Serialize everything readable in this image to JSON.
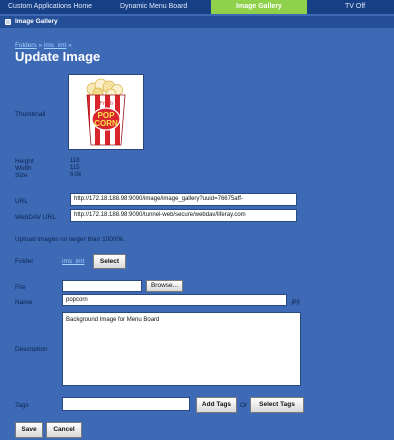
{
  "tabs": [
    {
      "label": "Custom Applications Home",
      "active": false
    },
    {
      "label": "Dynamic Menu Board",
      "active": false
    },
    {
      "label": "Image Gallery",
      "active": true
    },
    {
      "label": "TV Off",
      "active": false
    }
  ],
  "portlet": {
    "title": "Image Gallery"
  },
  "breadcrumb": {
    "item1": "Folders",
    "item2": "ims_imt"
  },
  "page_title": "Update Image",
  "thumbnail": {
    "label": "Thumbnail",
    "brand": "Fresh",
    "text_line1": "POP",
    "text_line2": "CORN"
  },
  "metadata": {
    "height_label": "Height",
    "height_value": "118",
    "width_label": "Width",
    "width_value": "115",
    "size_label": "Size",
    "size_value": "6.0k"
  },
  "url": {
    "label": "URL",
    "value": "http://172.18.188.98:9090/image/image_gallery?uuid=76675aff-"
  },
  "webdav_url": {
    "label": "WebDAV URL",
    "value": "http://172.18.188.98:9090/tunnel-web/secure/webdav/liferay.com"
  },
  "upload_note": "Upload images no larger than 10000k.",
  "folder": {
    "label": "Folder",
    "link": "ims_imt",
    "select_button": "Select"
  },
  "file": {
    "label": "File",
    "value": "",
    "browse_button": "Browse..."
  },
  "name": {
    "label": "Name",
    "value": "popcorn",
    "extension": ".jpg"
  },
  "description": {
    "label": "Description",
    "value": "Background Image for Menu Board"
  },
  "tags": {
    "label": "Tags",
    "value": "",
    "add_button": "Add Tags",
    "or_text": "Or",
    "select_button": "Select Tags"
  },
  "actions": {
    "save": "Save",
    "cancel": "Cancel"
  },
  "colors": {
    "background": "#3d69b5",
    "tab_bar": "#173f86",
    "active_tab": "#8fd14b",
    "link": "#9ed3ff"
  }
}
